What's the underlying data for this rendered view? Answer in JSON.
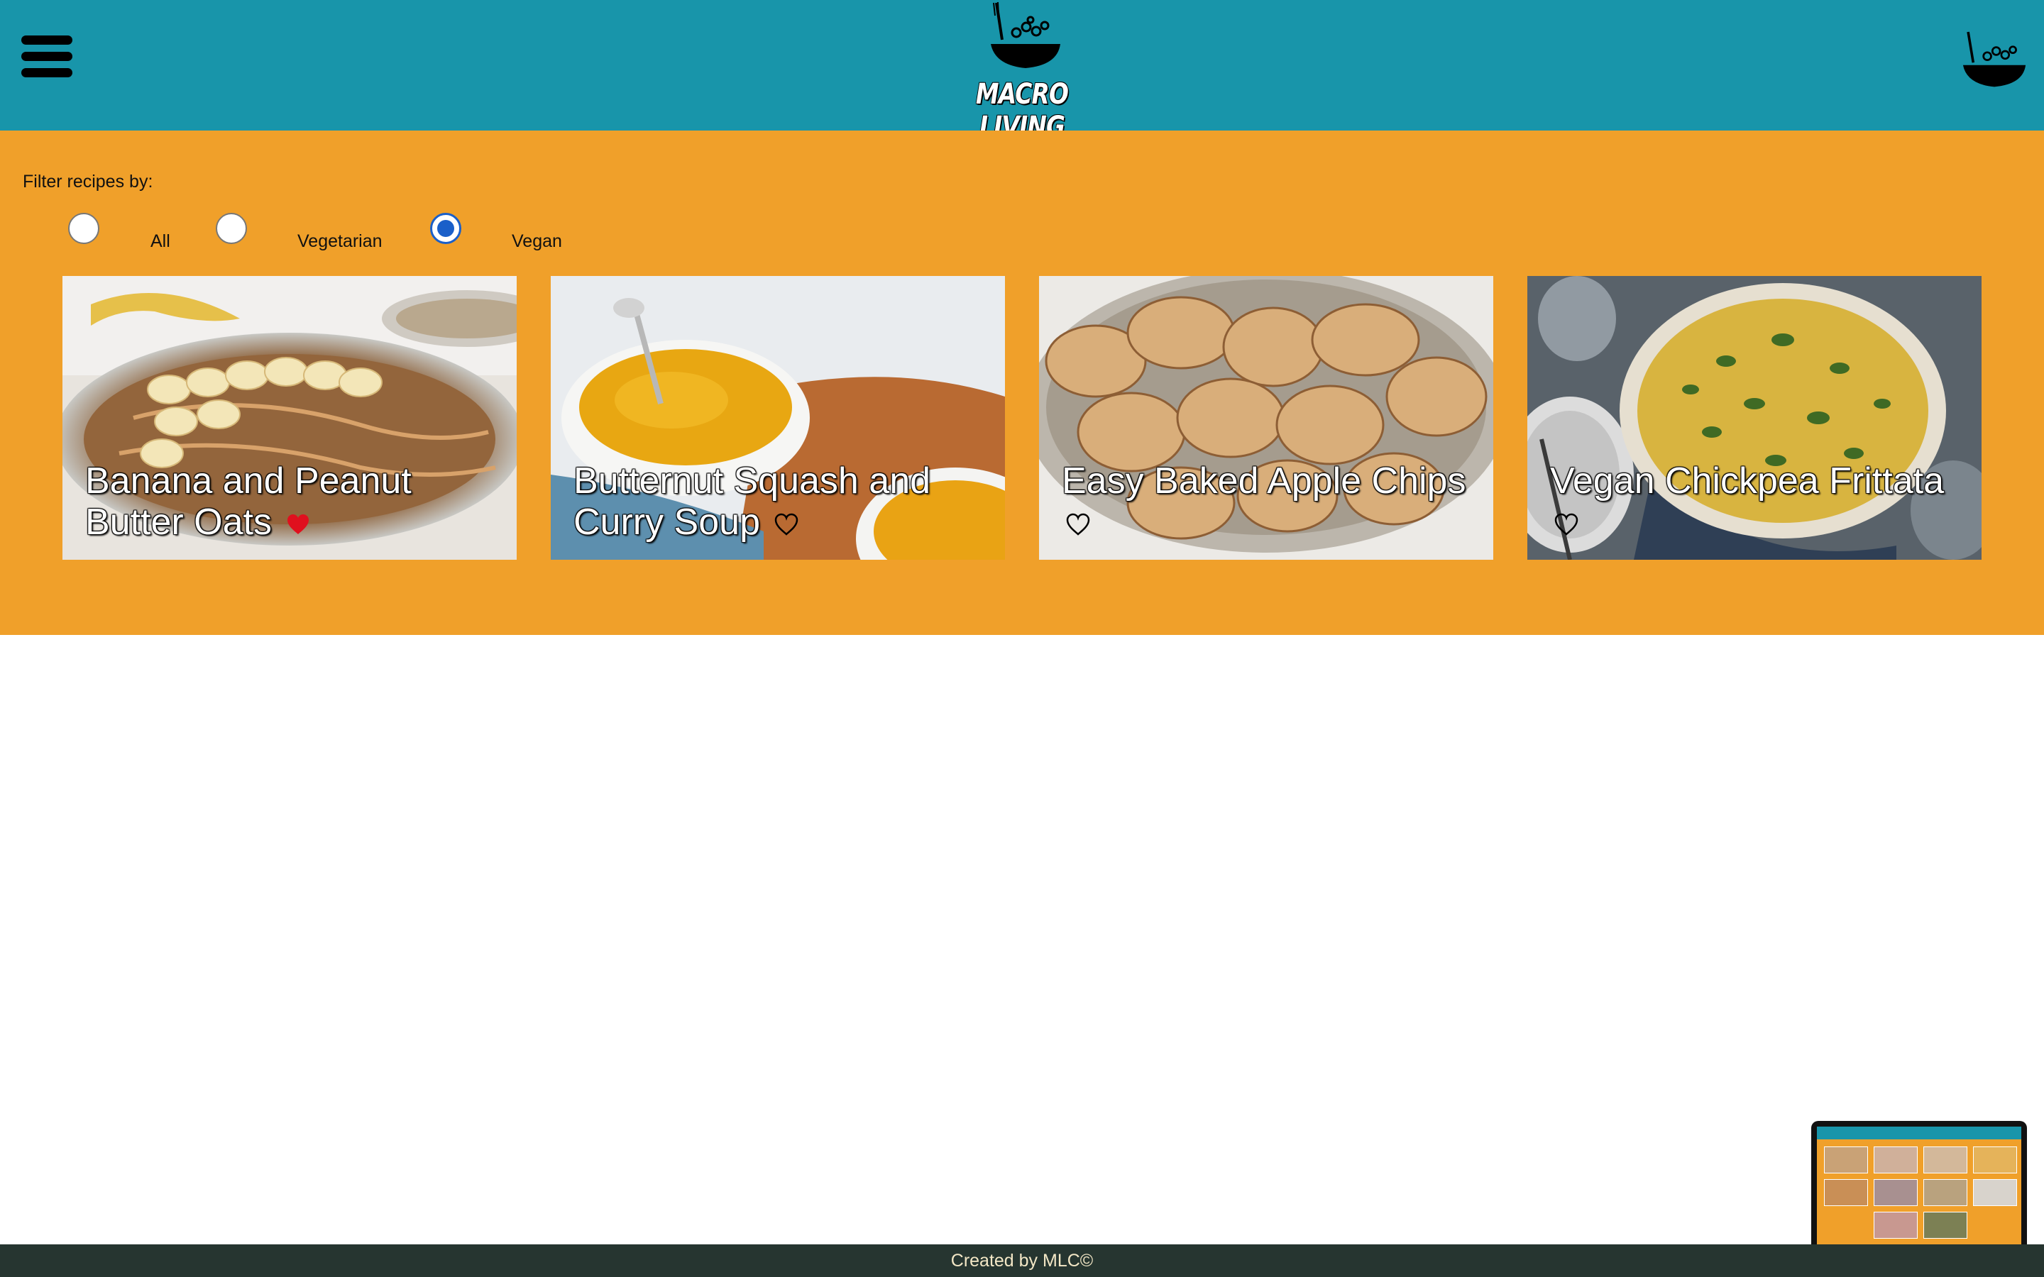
{
  "header": {
    "brand": "MACRO LIVING",
    "menu_icon": "hamburger-menu-icon",
    "logo_icon": "bowl-logo-icon",
    "colors": {
      "header_bg": "#1895aa",
      "main_bg": "#f0a02a",
      "footer_bg": "#263530",
      "heart_active": "#e0101e"
    }
  },
  "filter": {
    "label": "Filter recipes by:",
    "options": [
      {
        "label": "All",
        "checked": false
      },
      {
        "label": "Vegetarian",
        "checked": false
      },
      {
        "label": "Vegan",
        "checked": true
      }
    ]
  },
  "recipes": [
    {
      "title": "Banana and Peanut Butter Oats",
      "favorited": true,
      "image": "oats-with-banana-photo"
    },
    {
      "title": "Butternut Squash and Curry Soup",
      "favorited": false,
      "image": "squash-soup-photo"
    },
    {
      "title": "Easy Baked Apple Chips",
      "favorited": false,
      "image": "apple-chips-photo"
    },
    {
      "title": "Vegan Chickpea Frittata",
      "favorited": false,
      "image": "chickpea-frittata-photo"
    }
  ],
  "footer": {
    "text": "Created by MLC©"
  }
}
